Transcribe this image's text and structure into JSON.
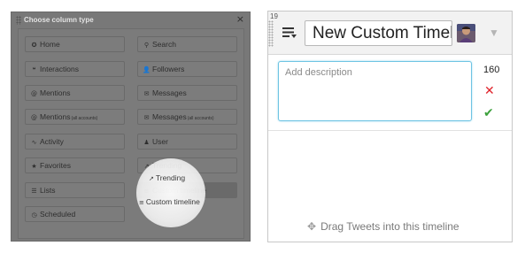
{
  "modal": {
    "title": "Choose column type",
    "close_glyph": "×",
    "options": [
      {
        "label": "Home",
        "icon": "home-icon",
        "glyph": "✪"
      },
      {
        "label": "Search",
        "icon": "search-icon",
        "glyph": "⚲"
      },
      {
        "label": "Interactions",
        "icon": "interactions-icon",
        "glyph": "❝"
      },
      {
        "label": "Followers",
        "icon": "followers-icon",
        "glyph": "👤"
      },
      {
        "label": "Mentions",
        "icon": "mentions-icon",
        "glyph": "@"
      },
      {
        "label": "Messages",
        "icon": "messages-icon",
        "glyph": "✉"
      },
      {
        "label": "Mentions",
        "sub": "(all accounts)",
        "icon": "mentions-all-icon",
        "glyph": "@"
      },
      {
        "label": "Messages",
        "sub": "(all accounts)",
        "icon": "messages-all-icon",
        "glyph": "✉"
      },
      {
        "label": "Activity",
        "icon": "activity-icon",
        "glyph": "∿"
      },
      {
        "label": "User",
        "icon": "user-icon",
        "glyph": "♟"
      },
      {
        "label": "Favorites",
        "icon": "favorites-icon",
        "glyph": "★"
      },
      {
        "label": "Trending",
        "icon": "trending-icon",
        "glyph": "↗"
      },
      {
        "label": "Lists",
        "icon": "lists-icon",
        "glyph": "☰"
      },
      {
        "label": "Custom timeline",
        "icon": "custom-timeline-icon",
        "glyph": "≡"
      },
      {
        "label": "Scheduled",
        "icon": "scheduled-icon",
        "glyph": "◷"
      }
    ]
  },
  "panel": {
    "column_number": "19",
    "title_value": "New Custom Timeli",
    "description_placeholder": "Add description",
    "char_count": "160",
    "cancel_glyph": "✕",
    "confirm_glyph": "✔",
    "drag_hint": "Drag Tweets into this timeline",
    "drag_hint_glyph": "✥",
    "menu_glyph": "▼"
  },
  "colors": {
    "accent_blue": "#6ec4e3",
    "cancel_red": "#e0242c",
    "confirm_green": "#3da13d"
  }
}
